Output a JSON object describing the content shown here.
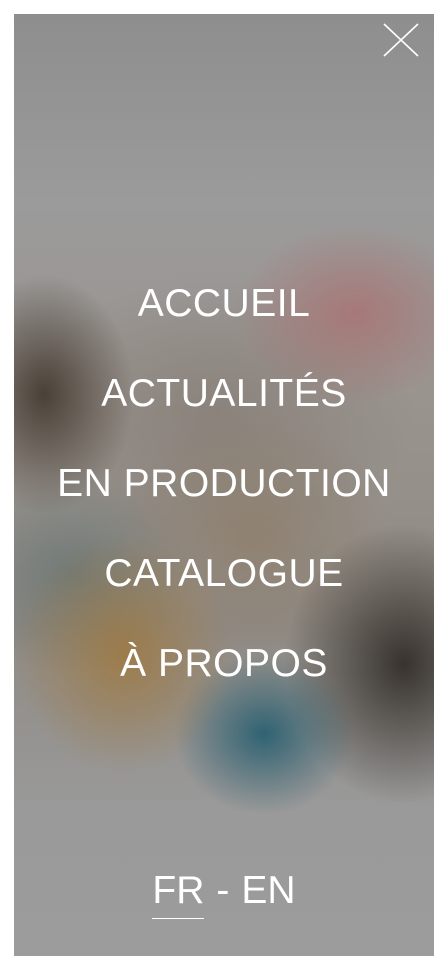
{
  "close": {
    "icon": "close-icon"
  },
  "menu": {
    "items": [
      {
        "label": "ACCUEIL"
      },
      {
        "label": "ACTUALITÉS"
      },
      {
        "label": "EN PRODUCTION"
      },
      {
        "label": "CATALOGUE"
      },
      {
        "label": "À PROPOS"
      }
    ]
  },
  "language": {
    "active": "FR",
    "separator": "-",
    "other": "EN"
  },
  "colors": {
    "text": "#ffffff",
    "overlay": "#9a9a9a"
  }
}
